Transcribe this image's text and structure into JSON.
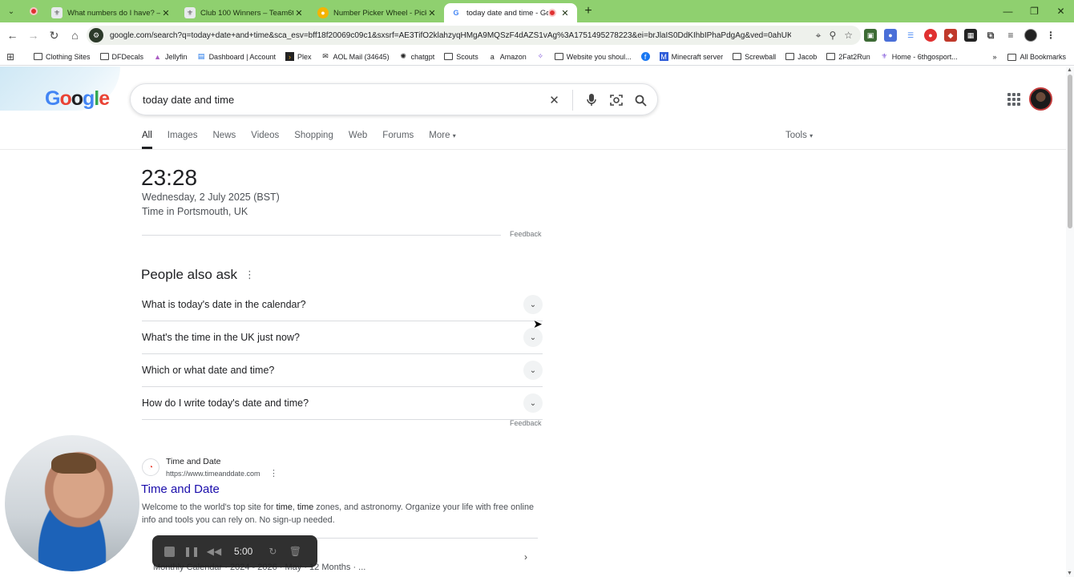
{
  "browser": {
    "tabs": [
      {
        "title": "What numbers do I have? – Te",
        "icon": "team6th-icon",
        "color": "#9aa0a6"
      },
      {
        "title": "Club 100 Winners – Team6th.o",
        "icon": "team6th-icon",
        "color": "#9aa0a6"
      },
      {
        "title": "Number Picker Wheel - Pick R",
        "icon": "wheel-icon",
        "color": "#f4b400"
      },
      {
        "title": "today date and time - Goo",
        "icon": "google-icon",
        "color": "#4285f4",
        "active": true
      }
    ],
    "new_tab": "+",
    "window_controls": {
      "minimize": "—",
      "maximize": "❐",
      "close": "✕"
    },
    "url": "google.com/search?q=today+date+and+time&sca_esv=bff18f20069c09c1&sxsrf=AE3TifO2klahzyqHMgA9MQSzF4dAZS1vAg%3A1751495278223&ei=brJlaIS0DdKIhbIPhaPdgAg&ved=0ahUKEwiEo...",
    "bookmarks": [
      {
        "label": "Clothing Sites",
        "icon": "folder"
      },
      {
        "label": "DFDecals",
        "icon": "folder"
      },
      {
        "label": "Jellyfin",
        "icon": "jellyfin"
      },
      {
        "label": "Dashboard | Account",
        "icon": "dashboard"
      },
      {
        "label": "Plex",
        "icon": "plex"
      },
      {
        "label": "AOL Mail (34645)",
        "icon": "aol"
      },
      {
        "label": "chatgpt",
        "icon": "chatgpt"
      },
      {
        "label": "Scouts",
        "icon": "folder"
      },
      {
        "label": "Amazon",
        "icon": "amazon"
      },
      {
        "label": "",
        "icon": "star-logo"
      },
      {
        "label": "Website you shoul...",
        "icon": "folder"
      },
      {
        "label": "",
        "icon": "facebook"
      },
      {
        "label": "Minecraft server",
        "icon": "minecraft"
      },
      {
        "label": "Screwball",
        "icon": "folder"
      },
      {
        "label": "Jacob",
        "icon": "folder"
      },
      {
        "label": "2Fat2Run",
        "icon": "folder"
      },
      {
        "label": "Home - 6thgosport...",
        "icon": "home-logo"
      }
    ],
    "bookmarks_overflow": "»",
    "all_bookmarks": "All Bookmarks"
  },
  "search": {
    "logo_letters": [
      "G",
      "o",
      "o",
      "g",
      "l",
      "e"
    ],
    "query": "today date and time",
    "tabs": [
      "All",
      "Images",
      "News",
      "Videos",
      "Shopping",
      "Web",
      "Forums",
      "More"
    ],
    "tools": "Tools"
  },
  "clock": {
    "time": "23:28",
    "date": "Wednesday, 2 July 2025 (BST)",
    "location": "Time in Portsmouth, UK",
    "feedback": "Feedback"
  },
  "paa": {
    "title": "People also ask",
    "questions": [
      "What is today's date in the calendar?",
      "What's the time in the UK just now?",
      "Which or what date and time?",
      "How do I write today's date and time?"
    ],
    "feedback": "Feedback"
  },
  "result": {
    "site_name": "Time and Date",
    "url": "https://www.timeanddate.com",
    "title": "Time and Date",
    "snippet_parts": [
      "Welcome to the world's top site for ",
      "time",
      ", ",
      "time",
      " zones, and astronomy. Organize your life with free online info and tools you can rely on. No sign-up needed."
    ],
    "sitelinks": "Monthly Calendar · 2024 - 2026 · May · 12 Months · ..."
  },
  "recorder": {
    "time": "5:00"
  }
}
